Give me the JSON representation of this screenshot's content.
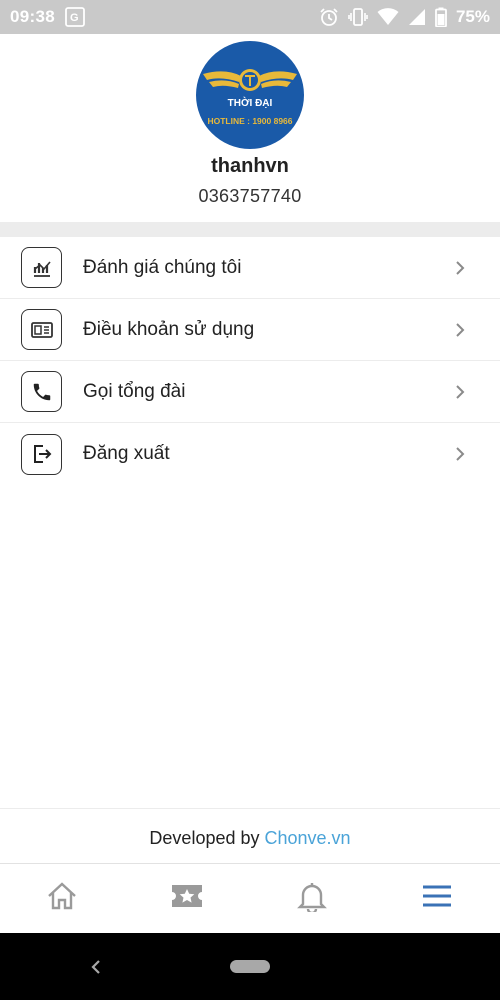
{
  "status_bar": {
    "time": "09:38",
    "battery": "75%",
    "icons": [
      "translate-icon",
      "alarm-icon",
      "vibrate-icon",
      "wifi-icon",
      "signal-icon",
      "battery-icon"
    ]
  },
  "profile": {
    "logo_text": "THỜI ĐẠI",
    "logo_hotline": "HOTLINE : 1900 8966",
    "username": "thanhvn",
    "phone": "0363757740"
  },
  "menu": {
    "items": [
      {
        "label": "Đánh giá chúng tôi",
        "icon": "chart-icon"
      },
      {
        "label": "Điều khoản sử dụng",
        "icon": "document-icon"
      },
      {
        "label": "Gọi tổng đài",
        "icon": "phone-icon"
      },
      {
        "label": "Đăng xuất",
        "icon": "logout-icon"
      }
    ]
  },
  "footer": {
    "developed_by": "Developed by ",
    "brand": "Chonve.vn"
  },
  "bottom_nav": {
    "items": [
      "home-icon",
      "ticket-icon",
      "bell-icon",
      "menu-icon"
    ],
    "active": "menu-icon",
    "active_color": "#3a72b6",
    "inactive_color": "#9a9a9a"
  },
  "colors": {
    "logo_blue": "#1a5aa8",
    "logo_gold": "#e8b93a",
    "brand_link": "#4aa3d8"
  }
}
